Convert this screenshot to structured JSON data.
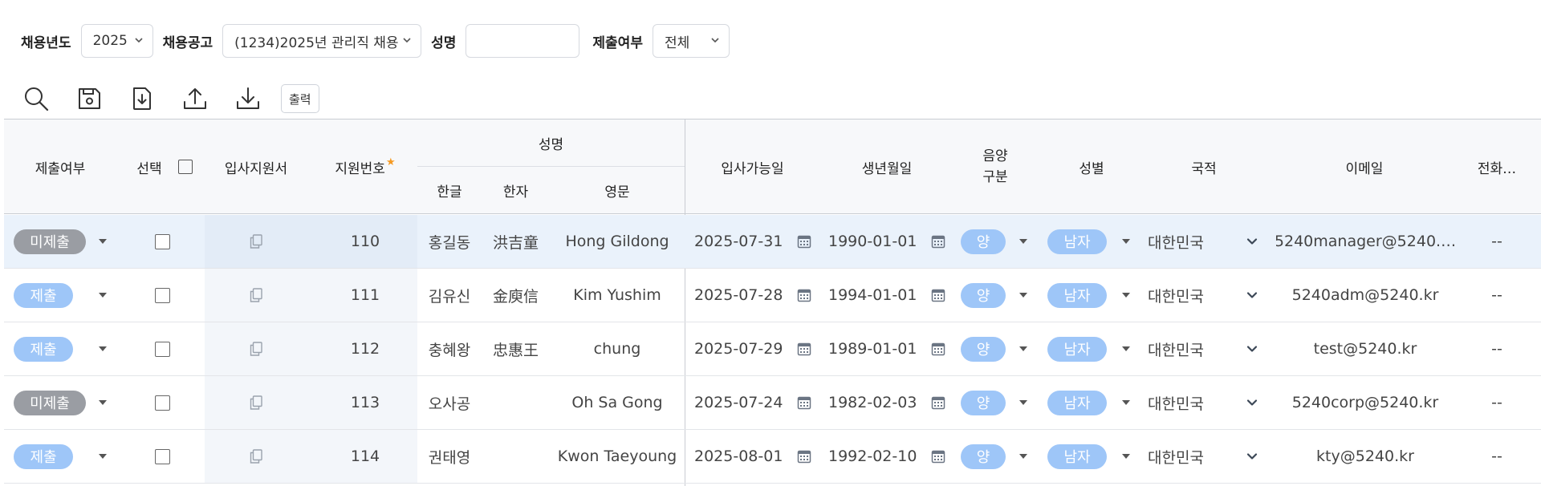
{
  "filters": {
    "year_label": "채용년도",
    "year_value": "2025",
    "notice_label": "채용공고",
    "notice_value": "(1234)2025년 관리직 채용",
    "name_label": "성명",
    "name_value": "",
    "submitted_label": "제출여부",
    "submitted_value": "전체"
  },
  "toolbar": {
    "icons": [
      "search-icon",
      "save-icon",
      "file-download-icon",
      "upload-icon",
      "download-icon"
    ],
    "print_label": "출력"
  },
  "grid": {
    "headers": {
      "submitted": "제출여부",
      "select": "선택",
      "application": "입사지원서",
      "applicant_no": "지원번호",
      "required_mark": "★",
      "name_group": "성명",
      "name_korean": "한글",
      "name_hanja": "한자",
      "name_english": "영문",
      "available_date": "입사가능일",
      "birth_date": "생년월일",
      "calendar_type_line1": "음양",
      "calendar_type_line2": "구분",
      "gender": "성별",
      "nationality": "국적",
      "email": "이메일",
      "phone": "전화…"
    },
    "rows": [
      {
        "status": "미제출",
        "status_color": "#9a9da3",
        "no": "110",
        "korean": "홍길동",
        "hanja": "洪吉童",
        "english": "Hong Gildong",
        "available": "2025-07-31",
        "birth": "1990-01-01",
        "lunar": "양",
        "gender": "남자",
        "nationality": "대한민국",
        "email": "5240manager@5240.…",
        "phone": "--",
        "selected": true
      },
      {
        "status": "제출",
        "status_color": "#9ec6f8",
        "no": "111",
        "korean": "김유신",
        "hanja": "金庾信",
        "english": "Kim Yushim",
        "available": "2025-07-28",
        "birth": "1994-01-01",
        "lunar": "양",
        "gender": "남자",
        "nationality": "대한민국",
        "email": "5240adm@5240.kr",
        "phone": "--",
        "selected": false
      },
      {
        "status": "제출",
        "status_color": "#9ec6f8",
        "no": "112",
        "korean": "충혜왕",
        "hanja": "忠惠王",
        "english": "chung",
        "available": "2025-07-29",
        "birth": "1989-01-01",
        "lunar": "양",
        "gender": "남자",
        "nationality": "대한민국",
        "email": "test@5240.kr",
        "phone": "--",
        "selected": false
      },
      {
        "status": "미제출",
        "status_color": "#9a9da3",
        "no": "113",
        "korean": "오사공",
        "hanja": "",
        "english": "Oh Sa Gong",
        "available": "2025-07-24",
        "birth": "1982-02-03",
        "lunar": "양",
        "gender": "남자",
        "nationality": "대한민국",
        "email": "5240corp@5240.kr",
        "phone": "--",
        "selected": false
      },
      {
        "status": "제출",
        "status_color": "#9ec6f8",
        "no": "114",
        "korean": "권태영",
        "hanja": "",
        "english": "Kwon Taeyoung",
        "available": "2025-08-01",
        "birth": "1992-02-10",
        "lunar": "양",
        "gender": "남자",
        "nationality": "대한민국",
        "email": "kty@5240.kr",
        "phone": "--",
        "selected": false
      }
    ]
  }
}
